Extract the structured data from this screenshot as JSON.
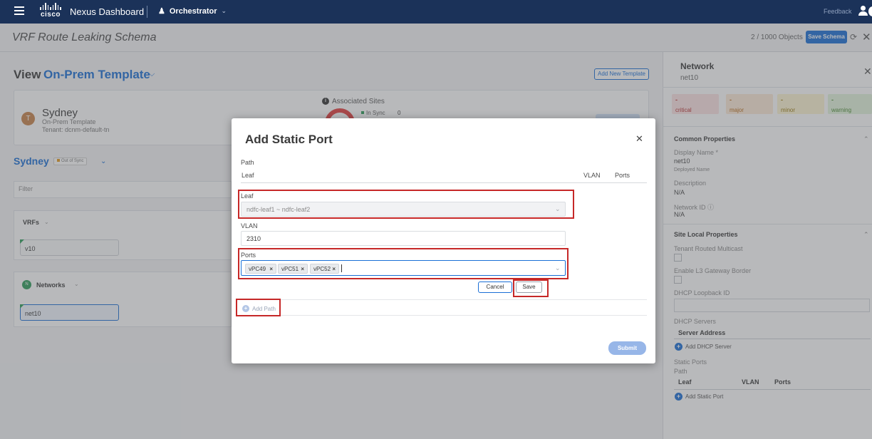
{
  "topbar": {
    "logo_text": "cisco",
    "app_title": "Nexus Dashboard",
    "service": "Orchestrator",
    "feedback": "Feedback"
  },
  "schema": {
    "title": "VRF Route Leaking Schema",
    "object_count": "2 / 1000 Objects",
    "save_label": "Save Schema"
  },
  "view": {
    "label": "View",
    "template_name": "On-Prem Template",
    "add_template_label": "Add New Template"
  },
  "site": {
    "avatar_letter": "T",
    "name": "Sydney",
    "type": "On-Prem Template",
    "tenant": "Tenant: dcnm-default-tn",
    "assoc_title": "Associated Sites",
    "in_sync_label": "In Sync",
    "in_sync_count": "0"
  },
  "site_section": {
    "title": "Sydney",
    "sync_status": "Out of Sync",
    "filter_placeholder": "Filter",
    "vrfs_label": "VRFs",
    "vrf_item": "v10",
    "networks_label": "Networks",
    "network_item": "net10"
  },
  "right_panel": {
    "title": "Network",
    "subtitle": "net10",
    "severities": [
      {
        "count": "-",
        "label": "critical"
      },
      {
        "count": "-",
        "label": "major"
      },
      {
        "count": "-",
        "label": "minor"
      },
      {
        "count": "-",
        "label": "warning"
      }
    ],
    "common_title": "Common Properties",
    "display_name_label": "Display Name *",
    "display_name_value": "net10",
    "deployed_name_label": "Deployed Name",
    "description_label": "Description",
    "description_value": "N/A",
    "network_id_label": "Network ID",
    "network_id_value": "N/A",
    "site_local_title": "Site Local Properties",
    "tenant_routed_label": "Tenant Routed Multicast",
    "enable_l3_label": "Enable L3 Gateway Border",
    "dhcp_loopback_label": "DHCP Loopback ID",
    "dhcp_servers_label": "DHCP Servers",
    "server_address_header": "Server Address",
    "add_dhcp_label": "Add DHCP Server",
    "static_ports_label": "Static Ports",
    "path_label": "Path",
    "col_leaf": "Leaf",
    "col_vlan": "VLAN",
    "col_ports": "Ports",
    "add_static_label": "Add Static Port"
  },
  "modal": {
    "title": "Add Static Port",
    "path_label": "Path",
    "columns": {
      "leaf": "Leaf",
      "vlan": "VLAN",
      "ports": "Ports"
    },
    "leaf_label": "Leaf",
    "leaf_value": "ndfc-leaf1 ~ ndfc-leaf2",
    "vlan_label": "VLAN",
    "vlan_value": "2310",
    "ports_label": "Ports",
    "ports": [
      "vPC49",
      "vPC51",
      "vPC52"
    ],
    "cancel_label": "Cancel",
    "save_label": "Save",
    "add_path_label": "Add Path",
    "submit_label": "Submit"
  },
  "colors": {
    "topbar": "#1b3259",
    "accent": "#1a6fd6",
    "highlight": "#c62828",
    "in_sync": "#2e9d5a",
    "donut": "#e33e3e"
  }
}
